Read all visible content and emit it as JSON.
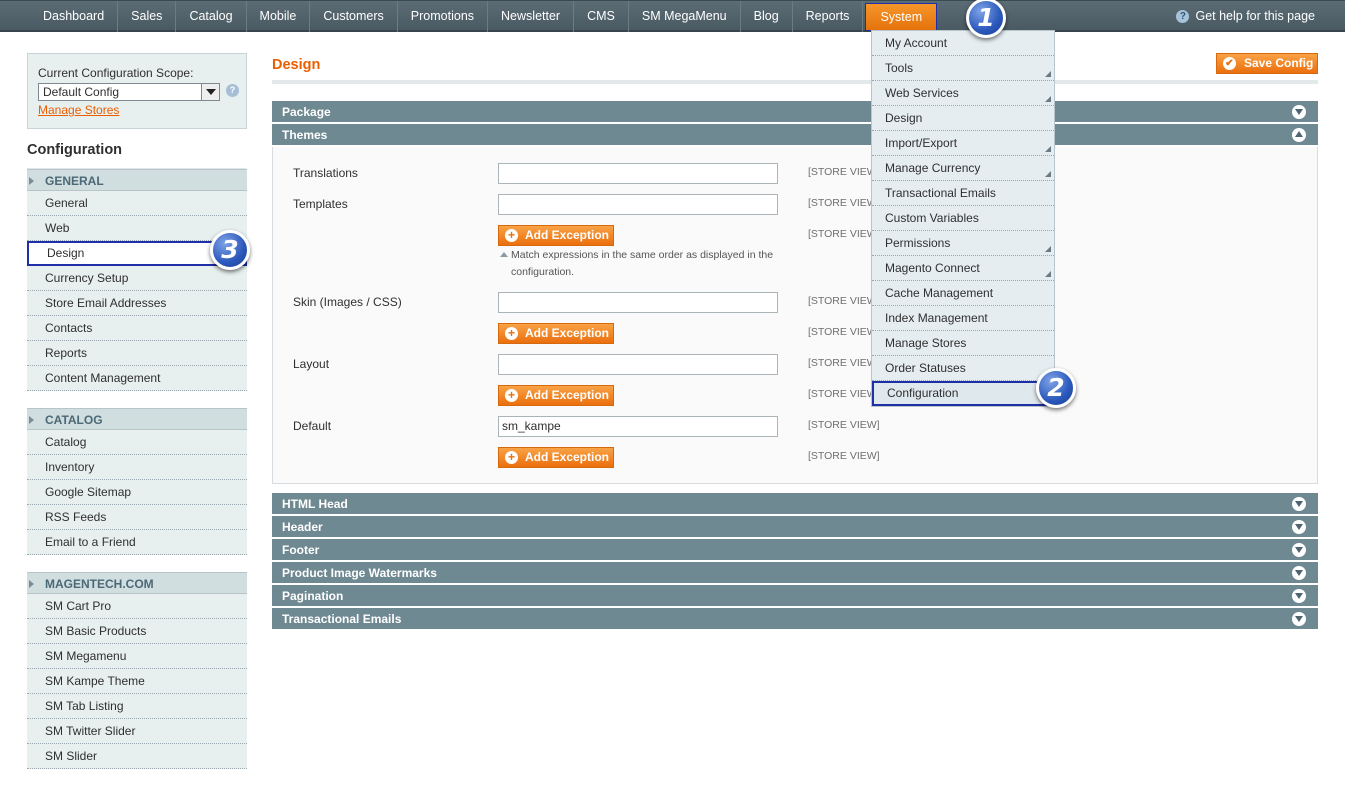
{
  "topnav": {
    "items": [
      "Dashboard",
      "Sales",
      "Catalog",
      "Mobile",
      "Customers",
      "Promotions",
      "Newsletter",
      "CMS",
      "SM MegaMenu",
      "Blog",
      "Reports",
      "System"
    ],
    "help": "Get help for this page"
  },
  "dropdown": {
    "items": [
      "My Account",
      "Tools",
      "Web Services",
      "Design",
      "Import/Export",
      "Manage Currency",
      "Transactional Emails",
      "Custom Variables",
      "Permissions",
      "Magento Connect",
      "Cache Management",
      "Index Management",
      "Manage Stores",
      "Order Statuses",
      "Configuration"
    ]
  },
  "badges": [
    "1",
    "2",
    "3"
  ],
  "sidebar": {
    "scope_label": "Current Configuration Scope:",
    "scope_value": "Default Config",
    "manage_stores": "Manage Stores",
    "title": "Configuration",
    "groups": [
      {
        "head": "GENERAL",
        "items": [
          "General",
          "Web",
          "Design",
          "Currency Setup",
          "Store Email Addresses",
          "Contacts",
          "Reports",
          "Content Management"
        ]
      },
      {
        "head": "CATALOG",
        "items": [
          "Catalog",
          "Inventory",
          "Google Sitemap",
          "RSS Feeds",
          "Email to a Friend"
        ]
      },
      {
        "head": "MAGENTECH.COM",
        "items": [
          "SM Cart Pro",
          "SM Basic Products",
          "SM Megamenu",
          "SM Kampe Theme",
          "SM Tab Listing",
          "SM Twitter Slider",
          "SM Slider"
        ]
      }
    ]
  },
  "main": {
    "title": "Design",
    "save_label": "Save Config",
    "sections": [
      "Package",
      "Themes",
      "HTML Head",
      "Header",
      "Footer",
      "Product Image Watermarks",
      "Pagination",
      "Transactional Emails"
    ],
    "fields": {
      "translations": "Translations",
      "templates": "Templates",
      "skin": "Skin (Images / CSS)",
      "layout": "Layout",
      "default": "Default",
      "default_value": "sm_kampe"
    },
    "add_exception": "Add Exception",
    "note": "Match expressions in the same order as displayed in the configuration.",
    "scope_tag": "[STORE VIEW]"
  },
  "colors": {
    "accent": "#eb5e00",
    "nav_bg": "#4a5a63",
    "section_bar": "#6f8992",
    "highlight_border": "#1f2fa8"
  }
}
